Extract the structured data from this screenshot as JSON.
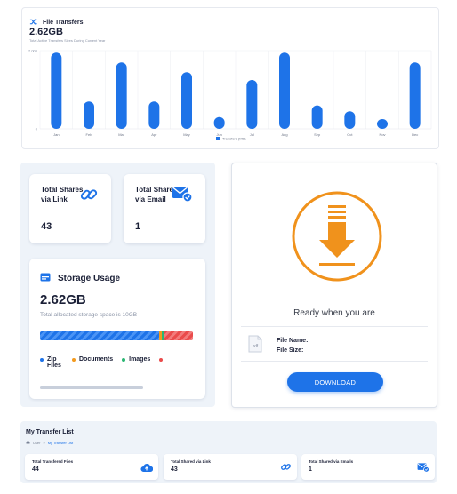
{
  "file_transfers": {
    "title": "File Transfers",
    "total": "2.62GB",
    "subtitle": "Total Active Transfers Sizes During Current Year",
    "icon": "shuffle-icon"
  },
  "chart_data": {
    "type": "bar",
    "categories": [
      "Jan",
      "Feb",
      "Mar",
      "Apr",
      "May",
      "Jun",
      "Jul",
      "Aug",
      "Sep",
      "Oct",
      "Nov",
      "Dec"
    ],
    "series": [
      {
        "name": "Transfers (MB)",
        "values": [
          1950,
          700,
          1700,
          700,
          1450,
          300,
          1250,
          1950,
          600,
          450,
          250,
          1700
        ]
      }
    ],
    "y_tick_labels": [
      "0",
      "2,000"
    ],
    "ylim": [
      0,
      2000
    ],
    "grid": true,
    "legend_position": "bottom",
    "color": "#1e73e8"
  },
  "shares": {
    "link": {
      "label": "Total Shares via Link",
      "value": "43",
      "icon": "link-icon"
    },
    "email": {
      "label": "Total Shares via Email",
      "value": "1",
      "icon": "email-check-icon"
    }
  },
  "storage": {
    "title": "Storage Usage",
    "total": "2.62GB",
    "subtitle": "Total allocated storage space is 10GB",
    "icon": "storage-icon",
    "segments": [
      {
        "name": "Zip Files",
        "fraction": 0.78,
        "color": "#1e73e8"
      },
      {
        "name": "Documents",
        "fraction": 0.015,
        "color": "#f39a1e"
      },
      {
        "name": "Images",
        "fraction": 0.015,
        "color": "#2bb673"
      },
      {
        "name": "",
        "fraction": 0.19,
        "color": "#ea4b4b"
      }
    ],
    "legend": [
      {
        "label": "Zip Files",
        "color": "#1e73e8"
      },
      {
        "label": "Documents",
        "color": "#f39a1e"
      },
      {
        "label": "Images",
        "color": "#2bb673"
      },
      {
        "label": "",
        "color": "#ea4b4b"
      }
    ]
  },
  "download": {
    "ready_text": "Ready when you are",
    "file_name_label": "File Name:",
    "file_size_label": "File Size:",
    "file_icon_text": "pdf",
    "button_label": "DOWNLOAD",
    "accent": "#f0921c"
  },
  "transfer_list": {
    "title": "My Transfer List",
    "breadcrumb": {
      "home": "User",
      "separator": "»",
      "current": "My Transfer List"
    },
    "cards": [
      {
        "label": "Total Transfered Files",
        "value": "44",
        "icon": "cloud-upload-icon"
      },
      {
        "label": "Total Shared via Link",
        "value": "43",
        "icon": "link-icon"
      },
      {
        "label": "Total Shared via Emails",
        "value": "1",
        "icon": "email-check-icon"
      }
    ]
  }
}
